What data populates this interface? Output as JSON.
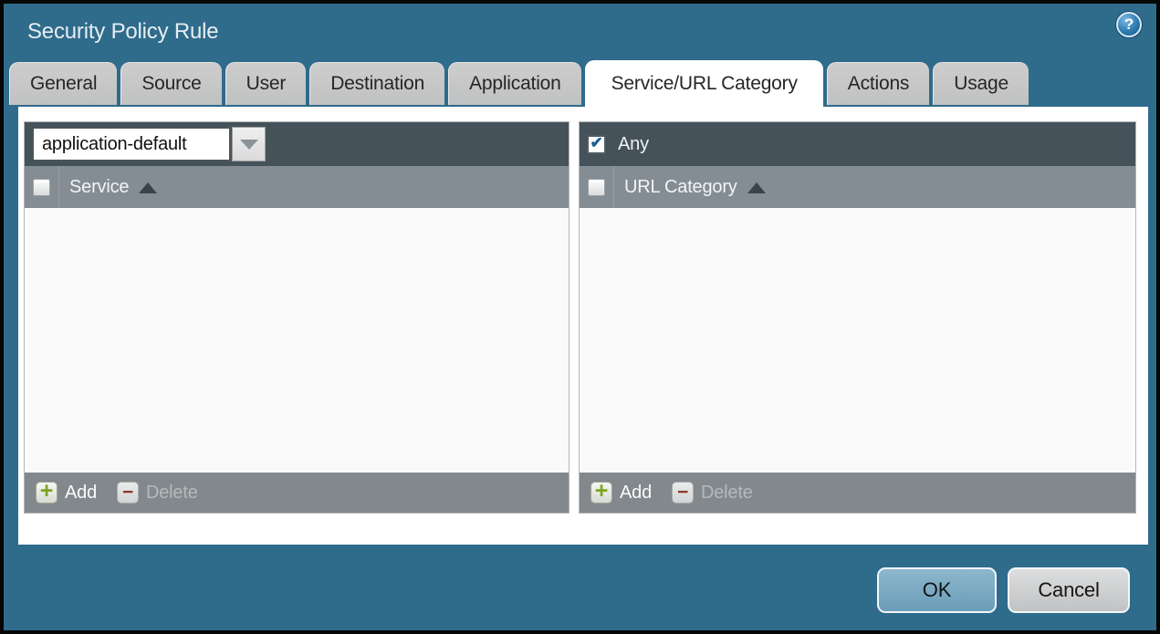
{
  "window": {
    "title": "Security Policy Rule"
  },
  "icons": {
    "help": "help-icon",
    "dropdown_arrow": "chevron-down-icon",
    "sort": "sort-ascending-icon",
    "add": "plus-icon",
    "delete": "minus-icon",
    "checked": "checkmark-icon"
  },
  "tabs": [
    {
      "label": "General",
      "active": false
    },
    {
      "label": "Source",
      "active": false
    },
    {
      "label": "User",
      "active": false
    },
    {
      "label": "Destination",
      "active": false
    },
    {
      "label": "Application",
      "active": false
    },
    {
      "label": "Service/URL Category",
      "active": true
    },
    {
      "label": "Actions",
      "active": false
    },
    {
      "label": "Usage",
      "active": false
    }
  ],
  "service_panel": {
    "dropdown": {
      "value": "application-default"
    },
    "header": {
      "label": "Service",
      "sort": "asc",
      "checkbox_checked": false
    },
    "rows": [],
    "toolbar": {
      "add_label": "Add",
      "delete_label": "Delete",
      "delete_enabled": false
    }
  },
  "url_category_panel": {
    "any": {
      "label": "Any",
      "checked": true
    },
    "header": {
      "label": "URL Category",
      "sort": "asc",
      "checkbox_checked": false
    },
    "rows": [],
    "toolbar": {
      "add_label": "Add",
      "delete_label": "Delete",
      "delete_enabled": false
    }
  },
  "footer": {
    "ok_label": "OK",
    "cancel_label": "Cancel"
  },
  "colors": {
    "background_teal": "#2f6b8b",
    "dark_bar": "#46525a",
    "column_header_gray": "#848d93",
    "footer_bar_gray": "#83888c",
    "tab_gray": "#c6c6c7",
    "active_tab": "#ffffff",
    "ok_button_blue": "#74a6bf",
    "cancel_button_gray": "#cfd1d2",
    "add_plus_green": "#7aa522",
    "delete_minus_red": "#8a392c",
    "check_blue": "#1e5f93"
  }
}
